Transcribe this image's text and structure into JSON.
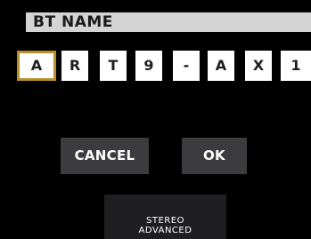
{
  "header": {
    "title": "BT NAME"
  },
  "name_editor": {
    "characters": [
      "A",
      "R",
      "T",
      "9",
      "-",
      "A",
      "X",
      "1"
    ],
    "selected_index": 0
  },
  "actions": {
    "cancel_label": "CANCEL",
    "ok_label": "OK"
  },
  "mode_indicator": {
    "line1": "STEREO",
    "line2": "ADVANCED"
  },
  "colors": {
    "background": "#000000",
    "title_bar": "#d4d4d4",
    "selection_border": "#b8902a",
    "button": "#3c3c3f"
  }
}
